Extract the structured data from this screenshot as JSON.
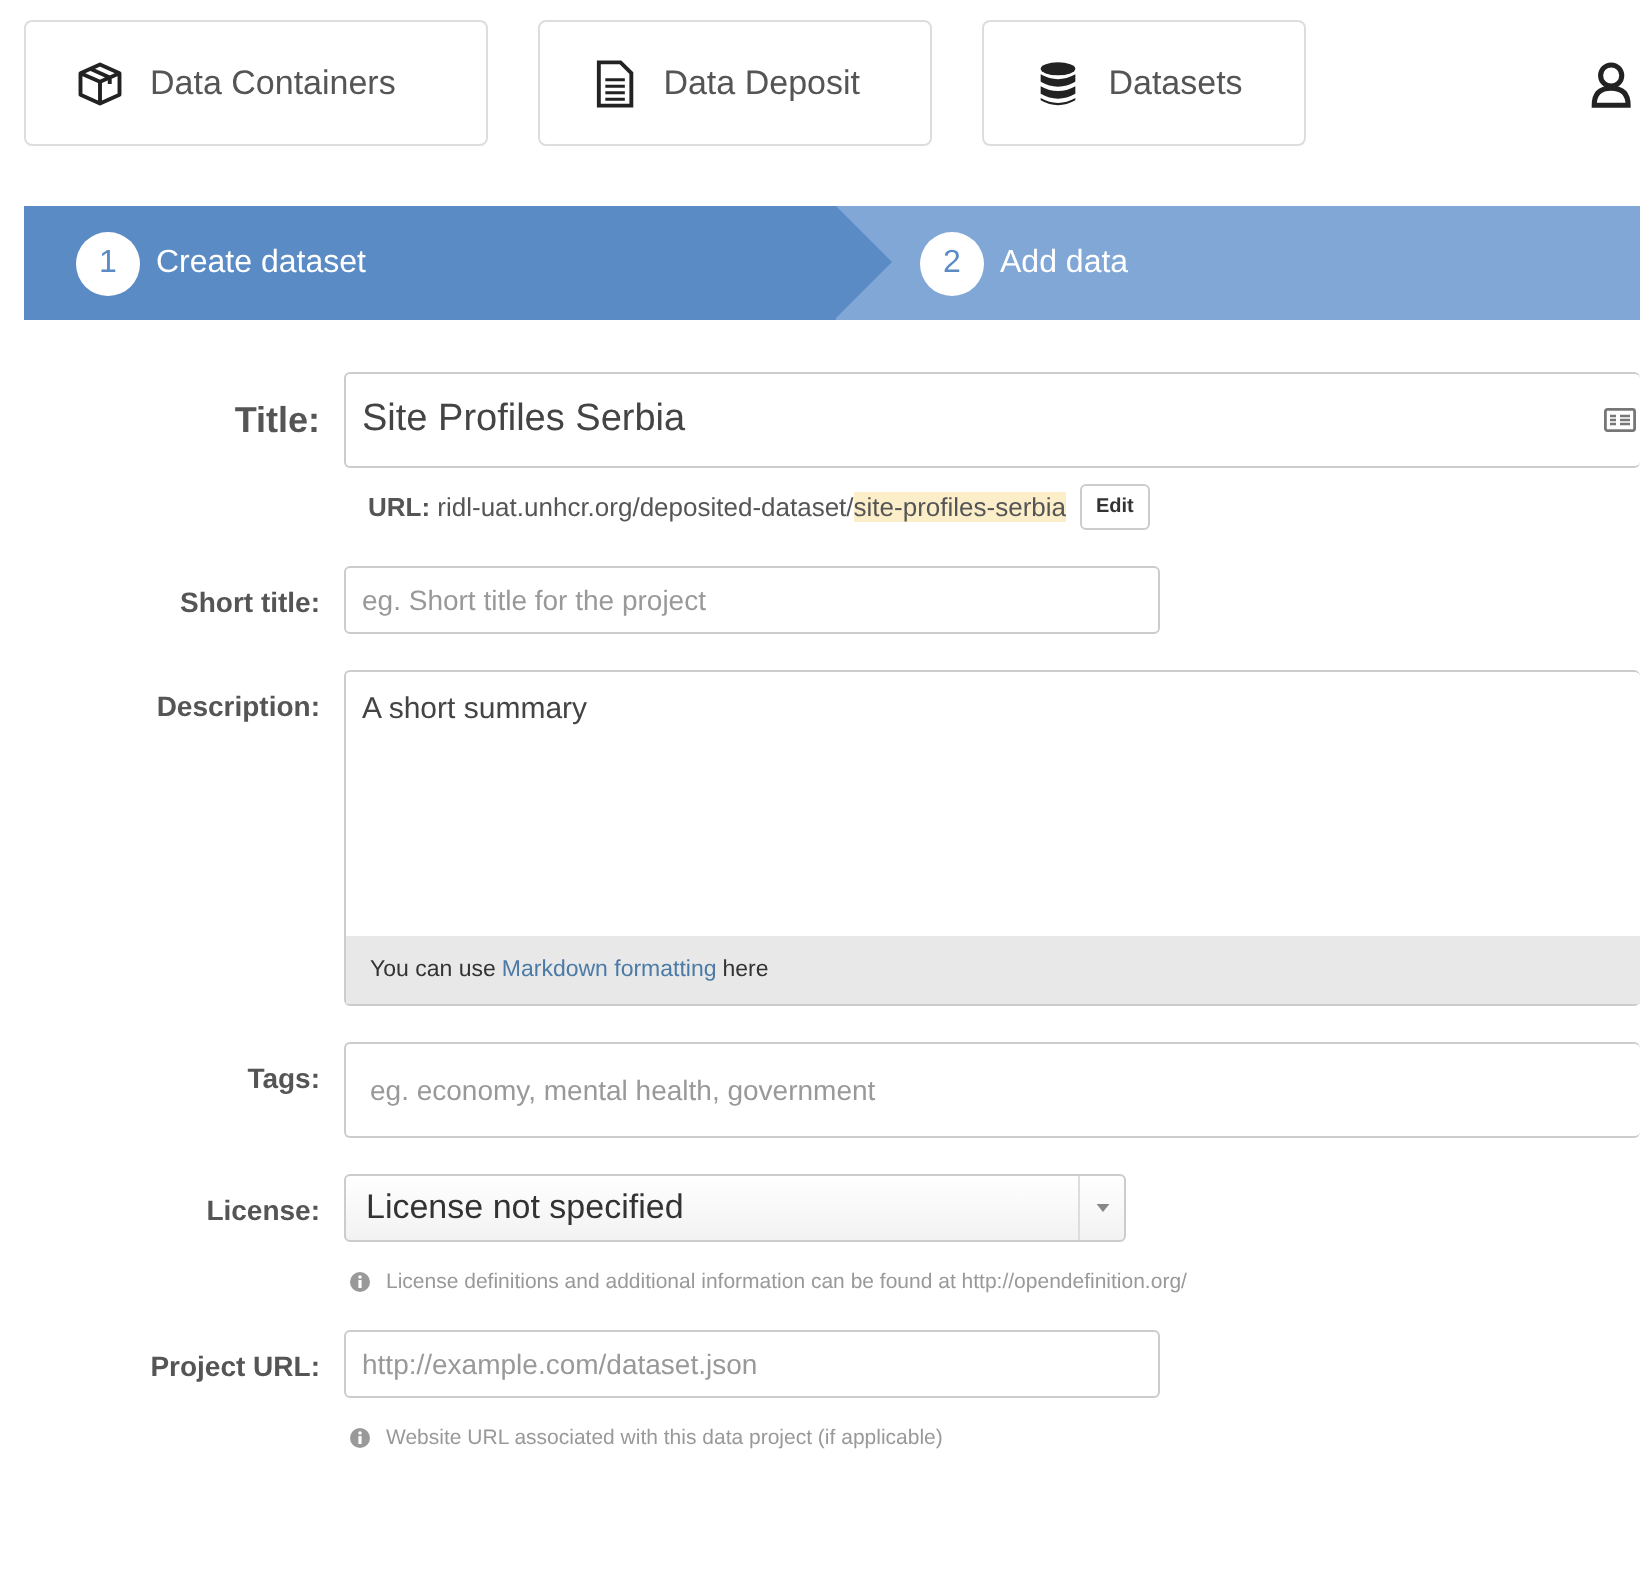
{
  "nav": [
    {
      "label": "Data Containers",
      "kind": "box"
    },
    {
      "label": "Data Deposit",
      "kind": "document"
    },
    {
      "label": "Datasets",
      "kind": "database"
    }
  ],
  "user_menu": {
    "kind": "user"
  },
  "steps": [
    {
      "number": "1",
      "label": "Create dataset",
      "selected": true
    },
    {
      "number": "2",
      "label": "Add data",
      "selected": false
    }
  ],
  "fields": [
    {
      "kind": "title",
      "label": "Title:",
      "value": "Site Profiles Serbia",
      "url_label": "URL:",
      "url_prefix": "ridl-uat.unhcr.org/deposited-dataset/",
      "url_slug": "site-profiles-serbia",
      "edit_button": "Edit"
    },
    {
      "kind": "text",
      "label": "Short title:",
      "placeholder": "eg. Short title for the project"
    },
    {
      "kind": "textarea",
      "label": "Description:",
      "value": "A short summary",
      "footer_before": "You can use",
      "footer_link": "Markdown formatting",
      "footer_after": "here"
    },
    {
      "kind": "tags",
      "label": "Tags:",
      "placeholder": "eg. economy, mental health, government"
    },
    {
      "kind": "select",
      "label": "License:",
      "value": "License not specified",
      "help": "License definitions and additional information can be found at http://opendefinition.org/"
    },
    {
      "kind": "text",
      "label": "Project URL:",
      "placeholder": "http://example.com/dataset.json",
      "help": "Website URL associated with this data project (if applicable)"
    }
  ]
}
